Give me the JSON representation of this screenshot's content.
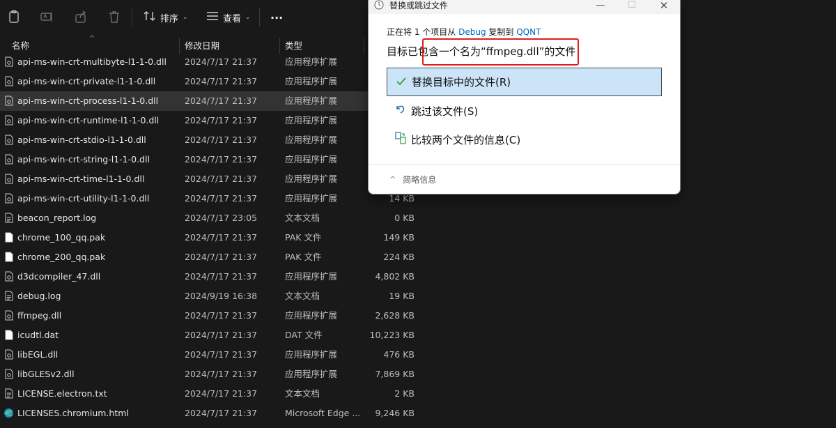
{
  "toolbar": {
    "sort_label": "排序",
    "view_label": "查看",
    "more_label": "···"
  },
  "columns": {
    "name": "名称",
    "modified": "修改日期",
    "type": "类型"
  },
  "files": [
    {
      "name": "api-ms-win-crt-multibyte-l1-1-0.dll",
      "date": "2024/7/17 21:37",
      "type": "应用程序扩展",
      "size": "",
      "icon": "dll-icon"
    },
    {
      "name": "api-ms-win-crt-private-l1-1-0.dll",
      "date": "2024/7/17 21:37",
      "type": "应用程序扩展",
      "size": "",
      "icon": "dll-icon"
    },
    {
      "name": "api-ms-win-crt-process-l1-1-0.dll",
      "date": "2024/7/17 21:37",
      "type": "应用程序扩展",
      "size": "",
      "icon": "dll-icon",
      "selected": true
    },
    {
      "name": "api-ms-win-crt-runtime-l1-1-0.dll",
      "date": "2024/7/17 21:37",
      "type": "应用程序扩展",
      "size": "",
      "icon": "dll-icon"
    },
    {
      "name": "api-ms-win-crt-stdio-l1-1-0.dll",
      "date": "2024/7/17 21:37",
      "type": "应用程序扩展",
      "size": "",
      "icon": "dll-icon"
    },
    {
      "name": "api-ms-win-crt-string-l1-1-0.dll",
      "date": "2024/7/17 21:37",
      "type": "应用程序扩展",
      "size": "",
      "icon": "dll-icon"
    },
    {
      "name": "api-ms-win-crt-time-l1-1-0.dll",
      "date": "2024/7/17 21:37",
      "type": "应用程序扩展",
      "size": "",
      "icon": "dll-icon"
    },
    {
      "name": "api-ms-win-crt-utility-l1-1-0.dll",
      "date": "2024/7/17 21:37",
      "type": "应用程序扩展",
      "size": "14 KB",
      "icon": "dll-icon"
    },
    {
      "name": "beacon_report.log",
      "date": "2024/7/17 23:05",
      "type": "文本文档",
      "size": "0 KB",
      "icon": "text-file-icon"
    },
    {
      "name": "chrome_100_qq.pak",
      "date": "2024/7/17 21:37",
      "type": "PAK 文件",
      "size": "149 KB",
      "icon": "file-icon"
    },
    {
      "name": "chrome_200_qq.pak",
      "date": "2024/7/17 21:37",
      "type": "PAK 文件",
      "size": "224 KB",
      "icon": "file-icon"
    },
    {
      "name": "d3dcompiler_47.dll",
      "date": "2024/7/17 21:37",
      "type": "应用程序扩展",
      "size": "4,802 KB",
      "icon": "dll-icon"
    },
    {
      "name": "debug.log",
      "date": "2024/9/19 16:38",
      "type": "文本文档",
      "size": "19 KB",
      "icon": "text-file-icon"
    },
    {
      "name": "ffmpeg.dll",
      "date": "2024/7/17 21:37",
      "type": "应用程序扩展",
      "size": "2,628 KB",
      "icon": "dll-icon"
    },
    {
      "name": "icudtl.dat",
      "date": "2024/7/17 21:37",
      "type": "DAT 文件",
      "size": "10,223 KB",
      "icon": "file-icon"
    },
    {
      "name": "libEGL.dll",
      "date": "2024/7/17 21:37",
      "type": "应用程序扩展",
      "size": "476 KB",
      "icon": "dll-icon"
    },
    {
      "name": "libGLESv2.dll",
      "date": "2024/7/17 21:37",
      "type": "应用程序扩展",
      "size": "7,869 KB",
      "icon": "dll-icon"
    },
    {
      "name": "LICENSE.electron.txt",
      "date": "2024/7/17 21:37",
      "type": "文本文档",
      "size": "2 KB",
      "icon": "text-file-icon"
    },
    {
      "name": "LICENSES.chromium.html",
      "date": "2024/7/17 21:37",
      "type": "Microsoft Edge ...",
      "size": "9,246 KB",
      "icon": "edge-icon"
    }
  ],
  "dialog": {
    "title": "替换或跳过文件",
    "copy_prefix": "正在将 1 个项目从",
    "source": "Debug",
    "copy_mid": "复制到",
    "dest": "QQNT",
    "message": "目标已包含一个名为“ffmpeg.dll”的文件",
    "options": {
      "replace": "替换目标中的文件(R)",
      "skip": "跳过该文件(S)",
      "compare": "比较两个文件的信息(C)"
    },
    "details": "简略信息",
    "colors": {
      "primary_bg": "#cce4f7",
      "link": "#0067c0",
      "highlight_box": "#e01d1d",
      "check": "#2f9d3a"
    }
  }
}
